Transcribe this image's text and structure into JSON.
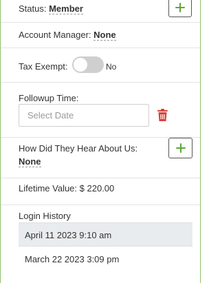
{
  "status": {
    "label": "Status:",
    "value": "Member"
  },
  "account_manager": {
    "label": "Account Manager:",
    "value": "None"
  },
  "tax_exempt": {
    "label": "Tax Exempt:",
    "toggle_text": "No",
    "enabled": false
  },
  "followup": {
    "label": "Followup Time:",
    "placeholder": "Select Date"
  },
  "hear_about": {
    "label": "How Did They Hear About Us:",
    "value": "None"
  },
  "lifetime": {
    "label": "Lifetime Value:",
    "value": "$ 220.00"
  },
  "login_history": {
    "title": "Login History",
    "entries": [
      "April 11 2023 9:10 am",
      "March 22 2023 3:09 pm"
    ]
  },
  "colors": {
    "accent_green": "#5aa63a",
    "border_green": "#8fc16f",
    "trash_red": "#d9433a",
    "highlight_row": "#e9ecee"
  },
  "icons": {
    "add": "plus-icon",
    "delete": "trash-icon"
  }
}
